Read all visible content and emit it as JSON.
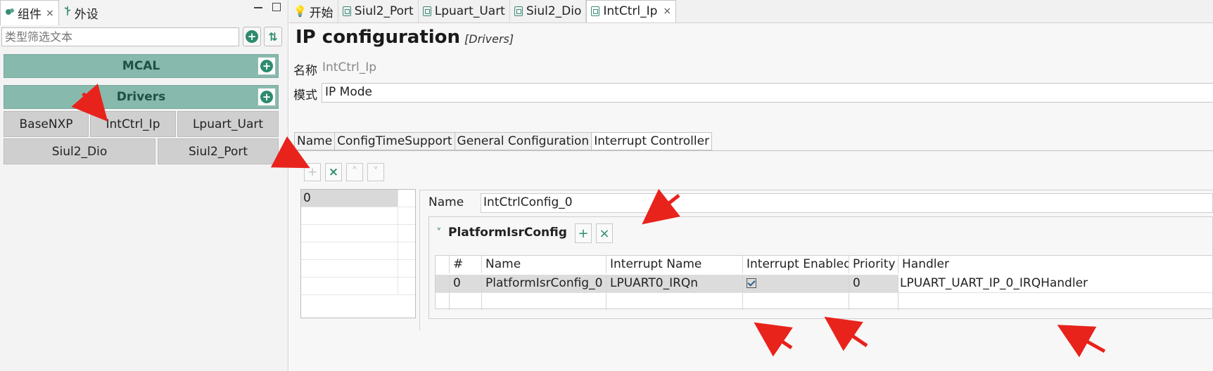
{
  "left_panel": {
    "tabs": [
      {
        "label": "组件",
        "active": true,
        "close": "×"
      },
      {
        "label": "外设",
        "active": false
      }
    ],
    "filter_placeholder": "类型筛选文本",
    "groups": [
      {
        "label": "MCAL"
      },
      {
        "label": "Drivers"
      }
    ],
    "components": [
      "BaseNXP",
      "IntCtrl_Ip",
      "Lpuart_Uart",
      "Siul2_Dio",
      "Siul2_Port"
    ]
  },
  "editor": {
    "tabs": [
      {
        "label": "开始",
        "icon": "bulb-icon"
      },
      {
        "label": "Siul2_Port",
        "icon": "component-icon"
      },
      {
        "label": "Lpuart_Uart",
        "icon": "component-icon"
      },
      {
        "label": "Siul2_Dio",
        "icon": "component-icon"
      },
      {
        "label": "IntCtrl_Ip",
        "icon": "component-icon",
        "active": true,
        "close": "×"
      }
    ],
    "title": "IP configuration",
    "subtitle": "[Drivers]",
    "name_label": "名称",
    "name_value": "IntCtrl_Ip",
    "mode_label": "模式",
    "mode_value": "IP Mode",
    "subtabs": [
      "Name",
      "ConfigTimeSupport",
      "General Configuration",
      "Interrupt Controller"
    ],
    "active_subtab": "Interrupt Controller",
    "list_items": [
      "0"
    ],
    "config_name_label": "Name",
    "config_name_value": "IntCtrlConfig_0",
    "section_title": "PlatformIsrConfig",
    "table": {
      "headers": [
        "#",
        "Name",
        "Interrupt Name",
        "Interrupt Enabled",
        "Priority",
        "Handler"
      ],
      "rows": [
        {
          "index": "0",
          "name": "PlatformIsrConfig_0",
          "interrupt_name": "LPUART0_IRQn",
          "enabled": true,
          "priority": "0",
          "handler": "LPUART_UART_IP_0_IRQHandler"
        }
      ]
    }
  },
  "colors": {
    "accent": "#2e8b6e",
    "group_bg": "#87b9ad",
    "arrow": "#e8231c"
  }
}
